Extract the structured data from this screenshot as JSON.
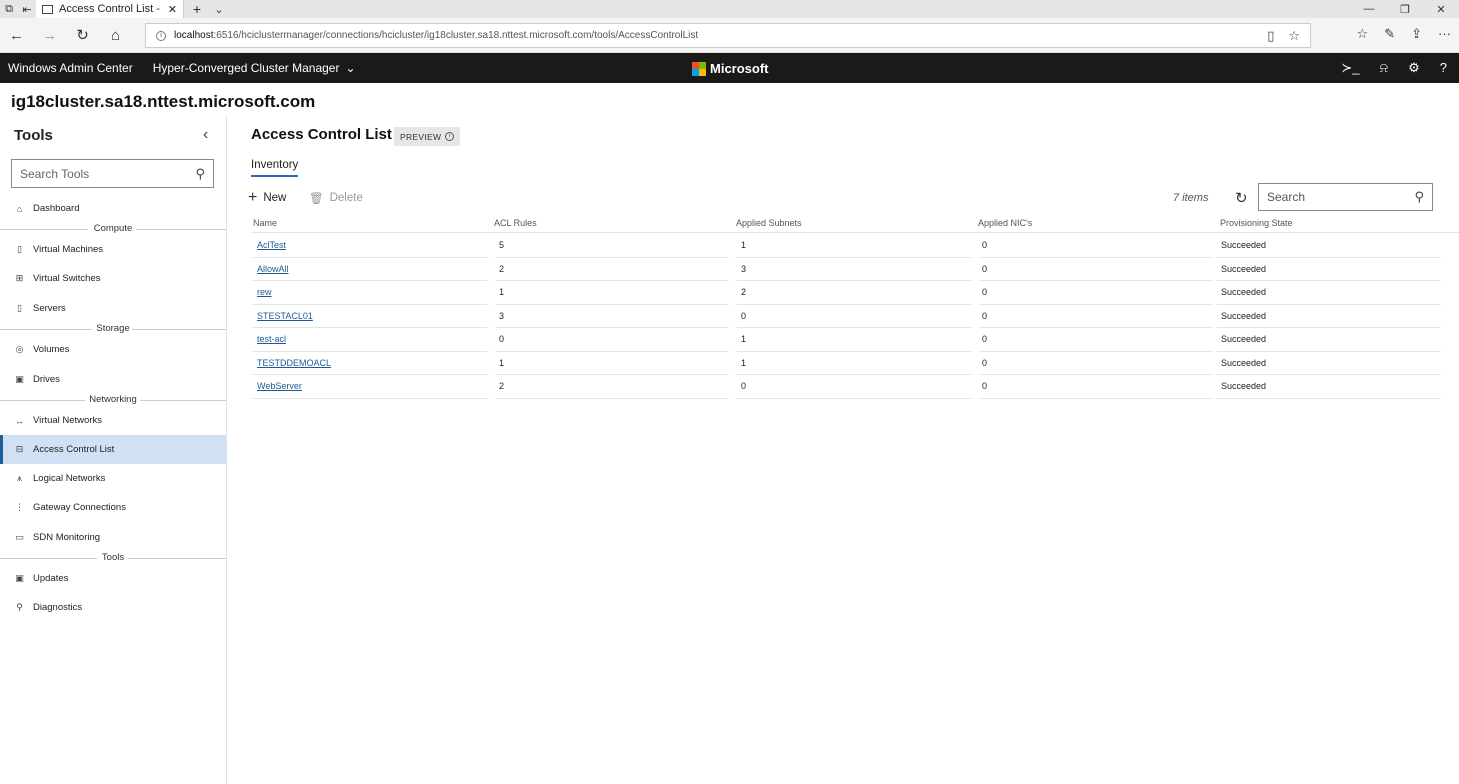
{
  "browser": {
    "tab_title": "Access Control List - Hy",
    "url_host": "localhost",
    "url_rest": ":6516/hciclustermanager/connections/hcicluster/ig18cluster.sa18.nttest.microsoft.com/tools/AccessControlList"
  },
  "header": {
    "brand": "Windows Admin Center",
    "manager": "Hyper-Converged Cluster Manager",
    "microsoft": "Microsoft",
    "logo_colors": [
      "#f25022",
      "#7fba00",
      "#00a4ef",
      "#ffb900"
    ]
  },
  "connection_title": "ig18cluster.sa18.nttest.microsoft.com",
  "sidebar": {
    "title": "Tools",
    "search_placeholder": "Search Tools",
    "items": [
      {
        "label": "Dashboard",
        "icon": "home-icon",
        "glyph": "⌂"
      },
      {
        "label": "Virtual Machines",
        "icon": "vm-icon",
        "glyph": "▯"
      },
      {
        "label": "Virtual Switches",
        "icon": "switch-icon",
        "glyph": "⊞"
      },
      {
        "label": "Servers",
        "icon": "server-icon",
        "glyph": "▯"
      },
      {
        "label": "Volumes",
        "icon": "volume-icon",
        "glyph": "◎"
      },
      {
        "label": "Drives",
        "icon": "drive-icon",
        "glyph": "▣"
      },
      {
        "label": "Virtual Networks",
        "icon": "virtual-network-icon",
        "glyph": "↔"
      },
      {
        "label": "Access Control List",
        "icon": "acl-icon",
        "glyph": "⊟"
      },
      {
        "label": "Logical Networks",
        "icon": "logical-network-icon",
        "glyph": "⩚"
      },
      {
        "label": "Gateway Connections",
        "icon": "gateway-icon",
        "glyph": "⋮"
      },
      {
        "label": "SDN Monitoring",
        "icon": "monitoring-icon",
        "glyph": "▭"
      },
      {
        "label": "Updates",
        "icon": "updates-icon",
        "glyph": "▣"
      },
      {
        "label": "Diagnostics",
        "icon": "diagnostics-icon",
        "glyph": "⚲"
      }
    ],
    "groups": [
      "Compute",
      "Storage",
      "Networking",
      "Tools"
    ]
  },
  "main": {
    "title": "Access Control List",
    "preview_label": "PREVIEW",
    "tab": "Inventory",
    "new_label": "New",
    "delete_label": "Delete",
    "count": "7 items",
    "search_placeholder": "Search",
    "columns": [
      "Name",
      "ACL Rules",
      "Applied Subnets",
      "Applied NIC's",
      "Provisioning State"
    ],
    "rows": [
      [
        "AclTest",
        "5",
        "1",
        "0",
        "Succeeded"
      ],
      [
        "AllowAll",
        "2",
        "3",
        "0",
        "Succeeded"
      ],
      [
        "rew",
        "1",
        "2",
        "0",
        "Succeeded"
      ],
      [
        "STESTACL01",
        "3",
        "0",
        "0",
        "Succeeded"
      ],
      [
        "test-acl",
        "0",
        "1",
        "0",
        "Succeeded"
      ],
      [
        "TESTDDEMOACL",
        "1",
        "1",
        "0",
        "Succeeded"
      ],
      [
        "WebServer",
        "2",
        "0",
        "0",
        "Succeeded"
      ]
    ]
  }
}
